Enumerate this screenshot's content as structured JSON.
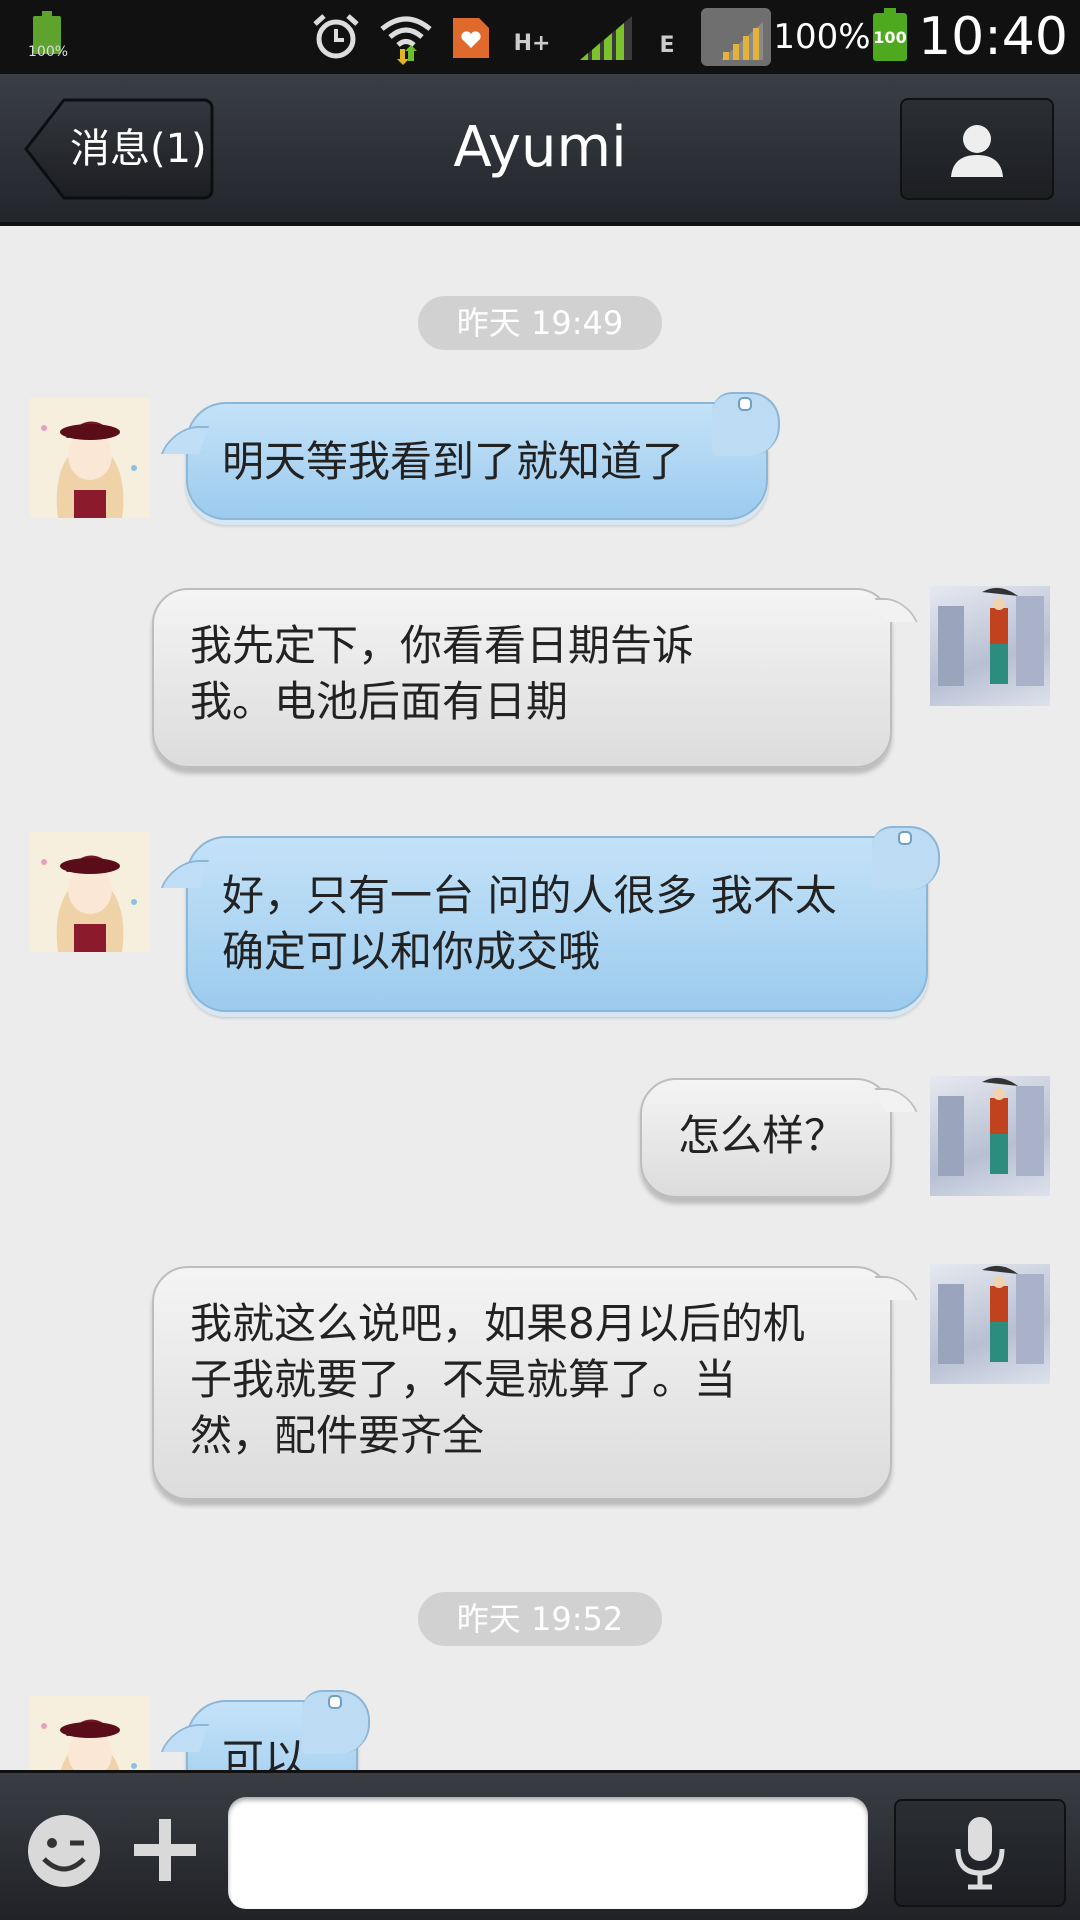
{
  "status_bar": {
    "left_battery_percent": "100%",
    "network_type_1": "H+",
    "network_type_2": "E",
    "battery_percent": "100%",
    "battery_icon_text": "100",
    "time": "10:40",
    "icons": [
      "battery-icon",
      "alarm-icon",
      "wifi-icon",
      "weibo-notification-icon",
      "signal-icon",
      "signal-icon-2",
      "battery-icon"
    ]
  },
  "header": {
    "back_label": "消息(1)",
    "title": "Ayumi",
    "profile_icon": "person-icon"
  },
  "chat": {
    "timestamps": [
      "昨天 19:49",
      "昨天 19:52"
    ],
    "messages": [
      {
        "sender": "other",
        "text": "明天等我看到了就知道了"
      },
      {
        "sender": "me",
        "text": "我先定下，你看看日期告诉",
        "text2": "我。电池后面有日期"
      },
      {
        "sender": "other",
        "text": "好，只有一台 问的人很多 我不太",
        "text2": "确定可以和你成交哦"
      },
      {
        "sender": "me",
        "text": "怎么样？"
      },
      {
        "sender": "me",
        "text": "我就这么说吧，如果8月以后的机",
        "text2": "子我就要了，不是就算了。当",
        "text3": "然，配件要齐全"
      },
      {
        "sender": "other",
        "text": "可以"
      }
    ]
  },
  "input_bar": {
    "icons": [
      "emoji-icon",
      "plus-icon",
      "microphone-icon"
    ],
    "input_value": ""
  },
  "colors": {
    "incoming_bubble": "#a8d3f2",
    "outgoing_bubble": "#e6e6e6",
    "chat_background": "#ececec",
    "header_background": "#2d3036"
  }
}
